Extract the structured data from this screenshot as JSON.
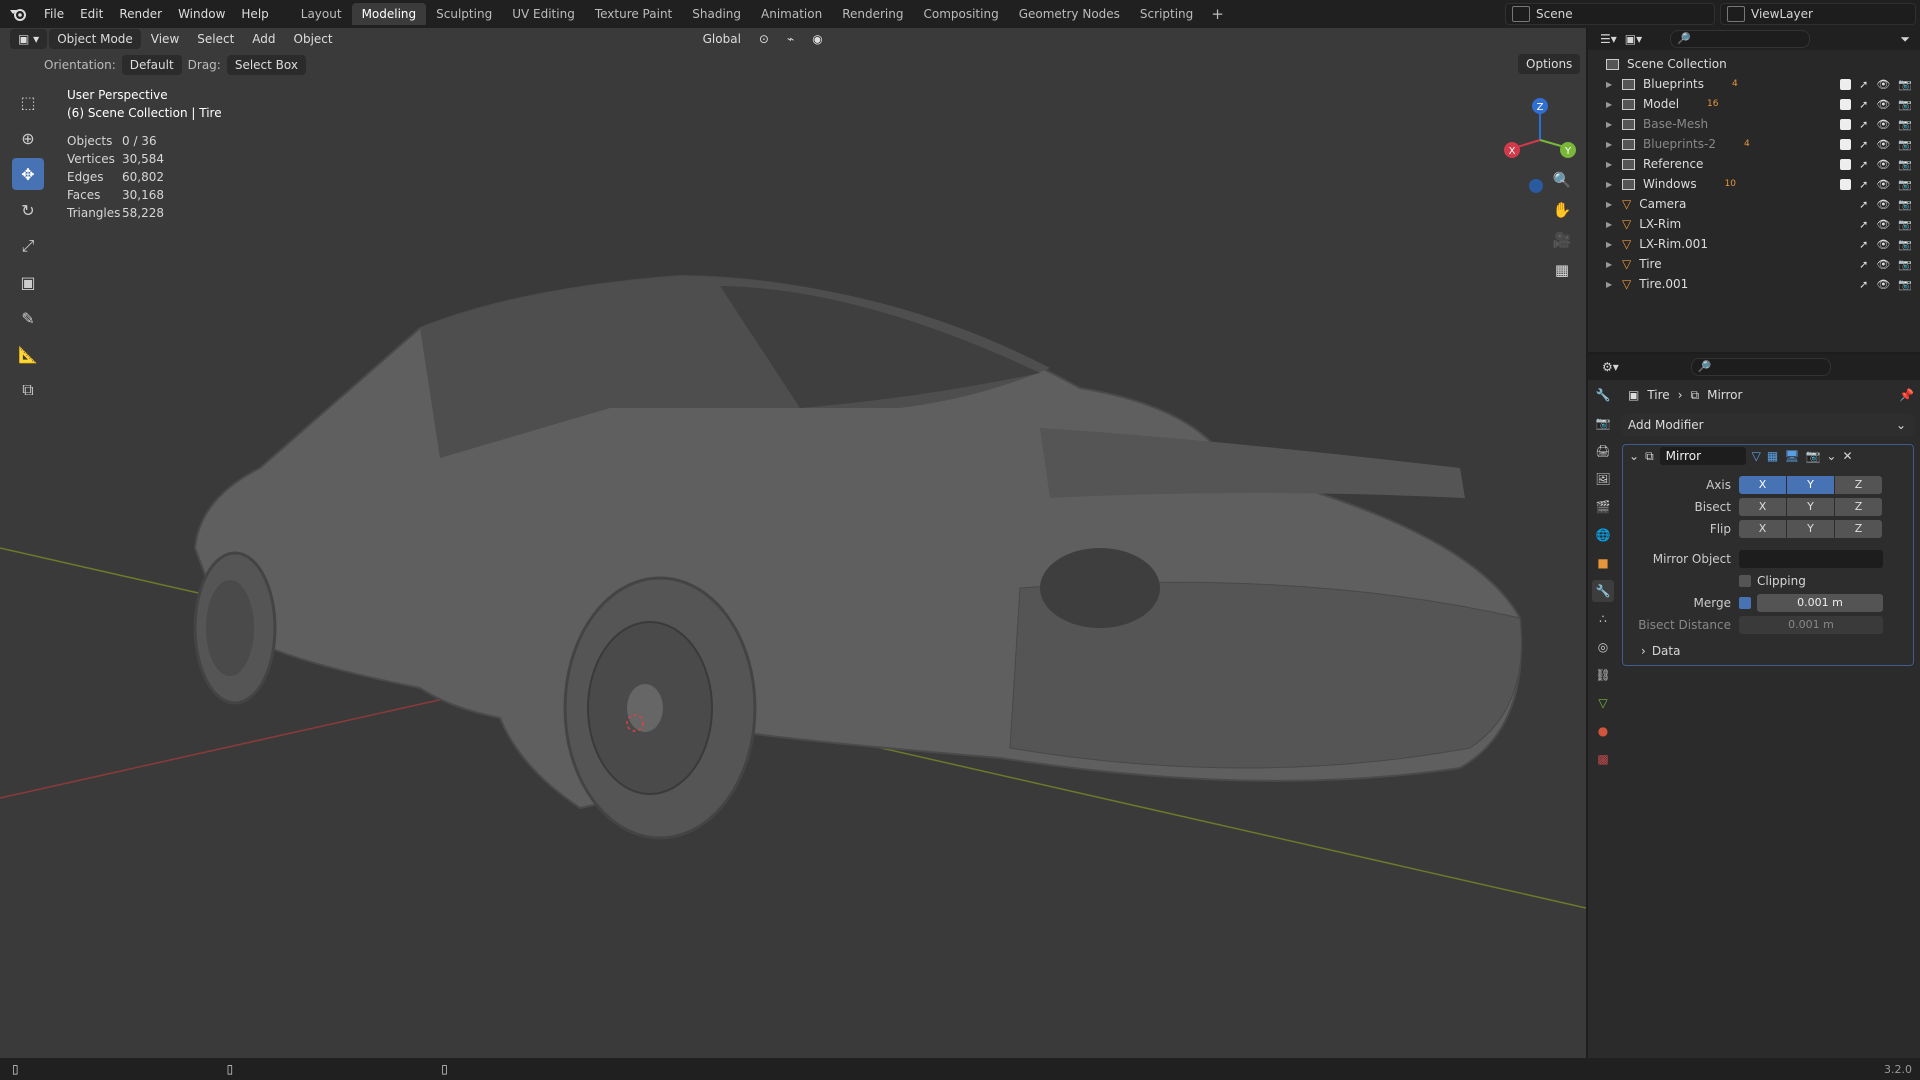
{
  "menubar": {
    "items": [
      "File",
      "Edit",
      "Render",
      "Window",
      "Help"
    ],
    "workspaces": [
      "Layout",
      "Modeling",
      "Sculpting",
      "UV Editing",
      "Texture Paint",
      "Shading",
      "Animation",
      "Rendering",
      "Compositing",
      "Geometry Nodes",
      "Scripting"
    ],
    "active_workspace": "Modeling",
    "add_tab": "+",
    "scene": "Scene",
    "view_layer": "ViewLayer"
  },
  "viewport_header": {
    "mode": "Object Mode",
    "menus": [
      "View",
      "Select",
      "Add",
      "Object"
    ],
    "transform_orientation": "Global",
    "orientation_label": "Orientation:",
    "orientation_value": "Default",
    "drag_label": "Drag:",
    "drag_value": "Select Box",
    "options": "Options"
  },
  "overlay": {
    "perspective": "User Perspective",
    "collection": "(6) Scene Collection | Tire"
  },
  "stats": [
    {
      "key": "Objects",
      "value": "0 / 36"
    },
    {
      "key": "Vertices",
      "value": "30,584"
    },
    {
      "key": "Edges",
      "value": "60,802"
    },
    {
      "key": "Faces",
      "value": "30,168"
    },
    {
      "key": "Triangles",
      "value": "58,228"
    }
  ],
  "gizmo": {
    "x": "X",
    "y": "Y",
    "z": "Z"
  },
  "outliner": {
    "root": "Scene Collection",
    "rows": [
      {
        "name": "Blueprints",
        "type": "collection",
        "badge": "4",
        "dim": false
      },
      {
        "name": "Model",
        "type": "collection",
        "badge": "16",
        "dim": false
      },
      {
        "name": "Base-Mesh",
        "type": "collection",
        "badge": "",
        "dim": true
      },
      {
        "name": "Blueprints-2",
        "type": "collection",
        "badge": "4",
        "dim": true
      },
      {
        "name": "Reference",
        "type": "collection",
        "badge": "",
        "dim": false
      },
      {
        "name": "Windows",
        "type": "collection",
        "badge": "10",
        "dim": false
      },
      {
        "name": "Camera",
        "type": "object",
        "badge": "",
        "dim": false
      },
      {
        "name": "LX-Rim",
        "type": "object",
        "badge": "",
        "dim": false
      },
      {
        "name": "LX-Rim.001",
        "type": "object",
        "badge": "",
        "dim": false
      },
      {
        "name": "Tire",
        "type": "object",
        "badge": "",
        "dim": false
      },
      {
        "name": "Tire.001",
        "type": "object",
        "badge": "",
        "dim": false
      }
    ]
  },
  "properties": {
    "breadcrumb_object": "Tire",
    "breadcrumb_modifier": "Mirror",
    "add_modifier": "Add Modifier",
    "modifier_name": "Mirror",
    "axis_label": "Axis",
    "bisect_label": "Bisect",
    "flip_label": "Flip",
    "axis_letters": [
      "X",
      "Y",
      "Z"
    ],
    "mirror_object_label": "Mirror Object",
    "clipping_label": "Clipping",
    "merge_label": "Merge",
    "merge_value": "0.001 m",
    "bisect_distance_label": "Bisect Distance",
    "bisect_distance_value": "0.001 m",
    "data_label": "Data"
  },
  "status": {
    "version": "3.2.0"
  }
}
